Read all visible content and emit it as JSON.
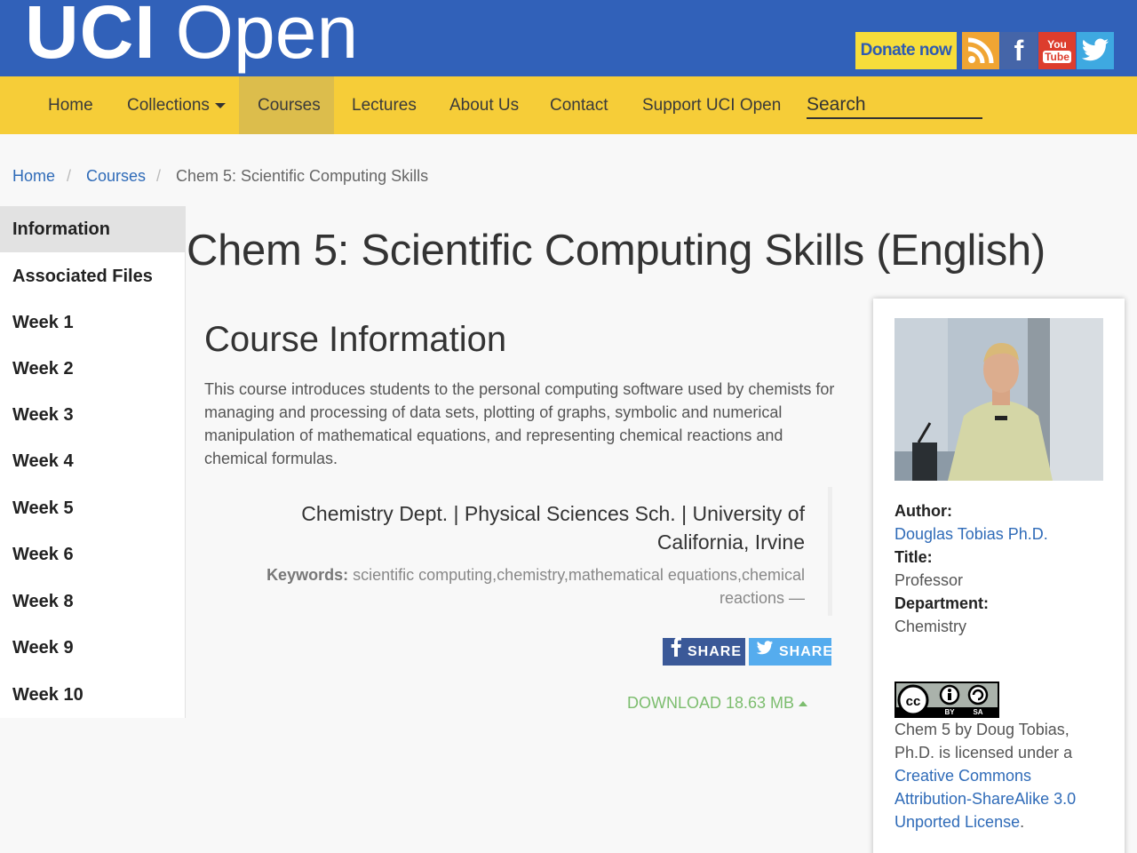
{
  "header": {
    "logo_bold": "UCI",
    "logo_light": "Open",
    "donate_label": "Donate now",
    "social_icons": [
      "rss-icon",
      "facebook-icon",
      "youtube-icon",
      "twitter-icon"
    ],
    "youtube_line1": "You",
    "youtube_line2": "Tube",
    "facebook_glyph": "f"
  },
  "colors": {
    "header_bg": "#3161b9",
    "nav_bg": "#f6cd38",
    "nav_active_bg": "#dcbd4c",
    "donate_bg": "#f7dd3a",
    "link": "#2f6bb8",
    "download": "#7cbd6e"
  },
  "nav": {
    "home": "Home",
    "collections": "Collections",
    "courses": "Courses",
    "lectures": "Lectures",
    "about": "About Us",
    "contact": "Contact",
    "support": "Support UCI Open",
    "search_placeholder": "Search"
  },
  "breadcrumb": {
    "home": "Home",
    "courses": "Courses",
    "current": "Chem 5: Scientific Computing Skills"
  },
  "sidebar": {
    "items": [
      "Information",
      "Associated Files",
      "Week 1",
      "Week 2",
      "Week 3",
      "Week 4",
      "Week 5",
      "Week 6",
      "Week 8",
      "Week 9",
      "Week 10"
    ]
  },
  "main": {
    "title": "Chem 5: Scientific Computing Skills (English)",
    "section_title": "Course Information",
    "description": "This course introduces students to the personal computing software used by chemists for managing and processing of data sets, plotting of graphs, symbolic and numerical manipulation of mathematical equations, and representing chemical reactions and chemical formulas.",
    "department": "Chemistry Dept. | Physical Sciences Sch. | University of California, Irvine",
    "keywords_label": "Keywords:",
    "keywords": "scientific computing,chemistry,mathematical equations,chemical reactions —",
    "share_label": "SHARE",
    "download_label": "DOWNLOAD 18.63 MB"
  },
  "author": {
    "author_label": "Author:",
    "author_name": "Douglas Tobias Ph.D.",
    "title_label": "Title:",
    "title_value": "Professor",
    "dept_label": "Department:",
    "dept_value": "Chemistry",
    "cc_by": "BY",
    "cc_sa": "SA",
    "license_text": "Chem 5 by Doug Tobias, Ph.D. is licensed under a",
    "license_link": "Creative Commons Attribution-ShareAlike 3.0 Unported License",
    "license_end": "."
  }
}
